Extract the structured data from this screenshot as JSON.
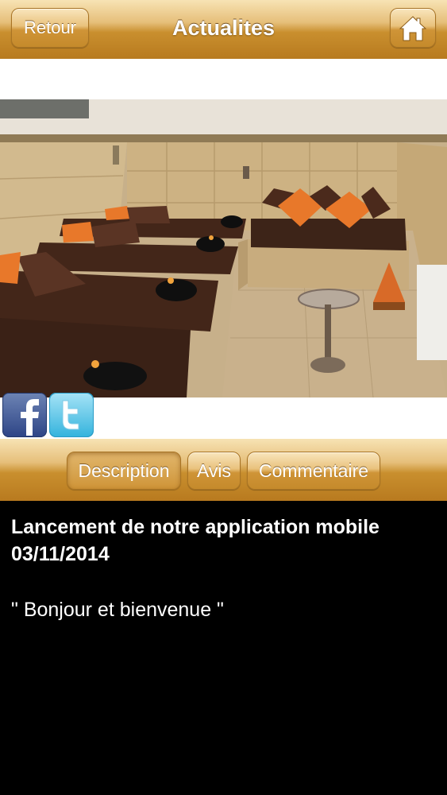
{
  "header": {
    "back_label": "Retour",
    "title": "Actualites",
    "home_icon": "home-icon"
  },
  "share": {
    "facebook_icon": "facebook-icon",
    "twitter_icon": "twitter-icon"
  },
  "tabs": [
    {
      "label": "Description",
      "selected": true
    },
    {
      "label": "Avis",
      "selected": false
    },
    {
      "label": "Commentaire",
      "selected": false
    }
  ],
  "article": {
    "title": "Lancement de notre application mobile",
    "date": "03/11/2014",
    "body": "\" Bonjour et bienvenue \""
  },
  "colors": {
    "accent_gold": "#c98f2e",
    "content_bg": "#000000",
    "text": "#ffffff"
  }
}
